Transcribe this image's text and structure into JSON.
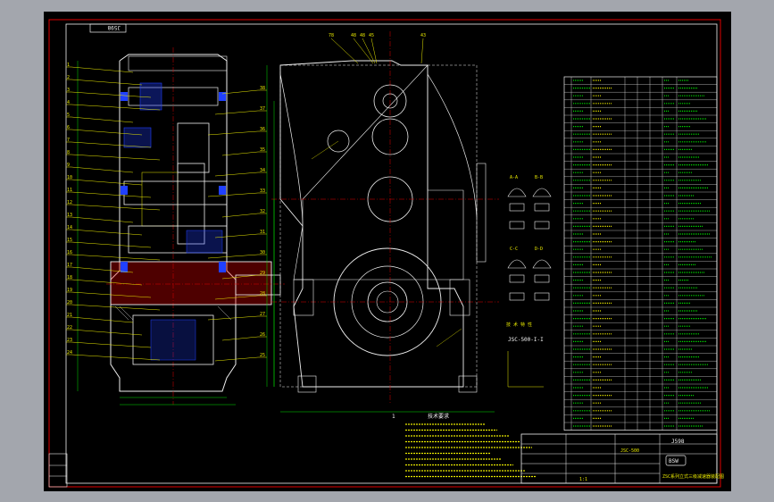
{
  "drawing": {
    "rotated_code": "J598",
    "front_view_number": "1",
    "callouts_top": [
      "78",
      "48",
      "48",
      "45",
      "43"
    ],
    "left_callouts": [
      "1",
      "2",
      "3",
      "4",
      "5",
      "6",
      "7",
      "8",
      "9",
      "10",
      "11",
      "12",
      "13",
      "14",
      "15",
      "16",
      "17",
      "18",
      "19",
      "20",
      "21",
      "22",
      "23",
      "24"
    ],
    "right_callouts": [
      "38",
      "37",
      "36",
      "35",
      "34",
      "33",
      "32",
      "31",
      "30",
      "29",
      "28",
      "27",
      "26",
      "25"
    ],
    "section_labels": [
      "A-A",
      "B-B",
      "C-C",
      "D-D"
    ],
    "center_label": "JSC-500-I-I",
    "tech_req_title": "技术要求",
    "detail_title": "技 术 特 性",
    "title_block": {
      "code": "J598",
      "model": "JSC-500",
      "logo": "BSW",
      "bottom_text": "ZSC系列立式三级减速器装配图",
      "scale": "1:1"
    }
  },
  "colors": {
    "background": "#000000",
    "frame": "#a3a6ad",
    "border_red": "#e00000",
    "line_white": "#f0f0f0",
    "line_yellow": "#e8e800",
    "line_green": "#00e000",
    "line_cyan": "#00e0e0",
    "line_blue": "#2040ff"
  }
}
